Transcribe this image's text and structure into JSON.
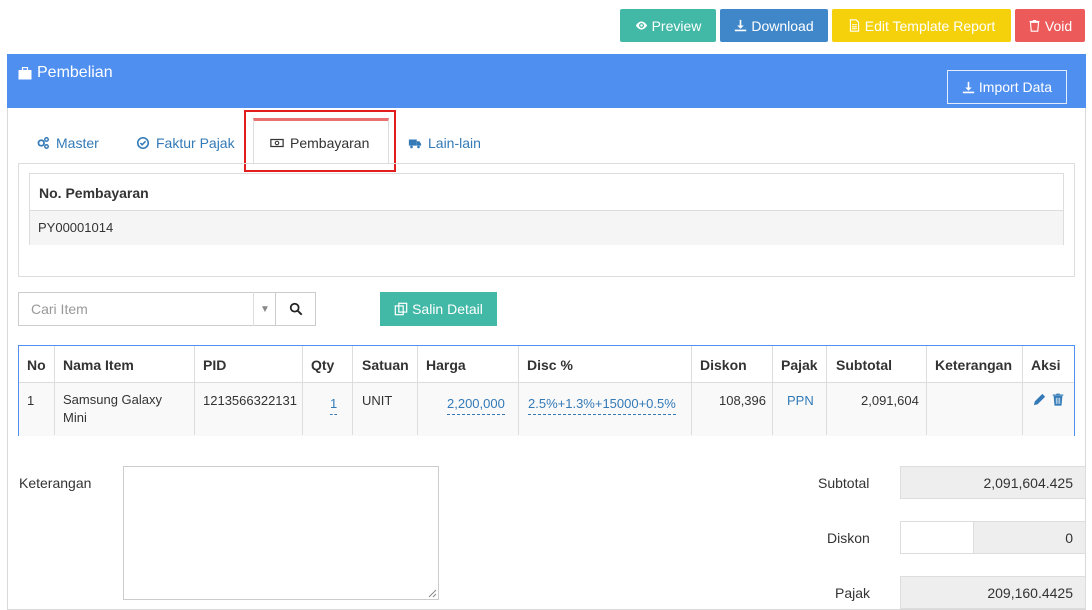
{
  "toolbar": {
    "preview_label": "Preview",
    "download_label": "Download",
    "edit_template_label": "Edit Template Report",
    "void_label": "Void"
  },
  "header": {
    "title": "Pembelian",
    "import_label": "Import Data"
  },
  "tabs": [
    {
      "label": "Master",
      "icon": "gears-icon"
    },
    {
      "label": "Faktur Pajak",
      "icon": "check-circle-icon"
    },
    {
      "label": "Pembayaran",
      "icon": "money-icon",
      "active": true
    },
    {
      "label": "Lain-lain",
      "icon": "truck-icon"
    }
  ],
  "payment": {
    "header": "No. Pembayaran",
    "value": "PY00001014"
  },
  "search": {
    "placeholder": "Cari Item",
    "salin_label": "Salin Detail"
  },
  "items": {
    "columns": [
      "No",
      "Nama Item",
      "PID",
      "Qty",
      "Satuan",
      "Harga",
      "Disc %",
      "Diskon",
      "Pajak",
      "Subtotal",
      "Keterangan",
      "Aksi"
    ],
    "rows": [
      {
        "no": "1",
        "nama_line1": "Samsung Galaxy",
        "nama_line2": "Mini",
        "pid": "1213566322131",
        "qty": "1",
        "satuan": "UNIT",
        "harga": "2,200,000",
        "disc": "2.5%+1.3%+15000+0.5%",
        "diskon": "108,396",
        "pajak": "PPN",
        "subtotal": "2,091,604",
        "keterangan": ""
      }
    ]
  },
  "footer": {
    "keterangan_label": "Keterangan",
    "subtotal_label": "Subtotal",
    "subtotal_value": "2,091,604.425",
    "diskon_label": "Diskon",
    "diskon_input": "",
    "diskon_value": "0",
    "pajak_label": "Pajak",
    "pajak_value": "209,160.4425"
  },
  "colors": {
    "preview": "#42b8a6",
    "download": "#3f87c8",
    "edit_template": "#f5d10b",
    "void": "#ec5a5a",
    "header_bar": "#4f8ff0",
    "link": "#337ab7"
  }
}
